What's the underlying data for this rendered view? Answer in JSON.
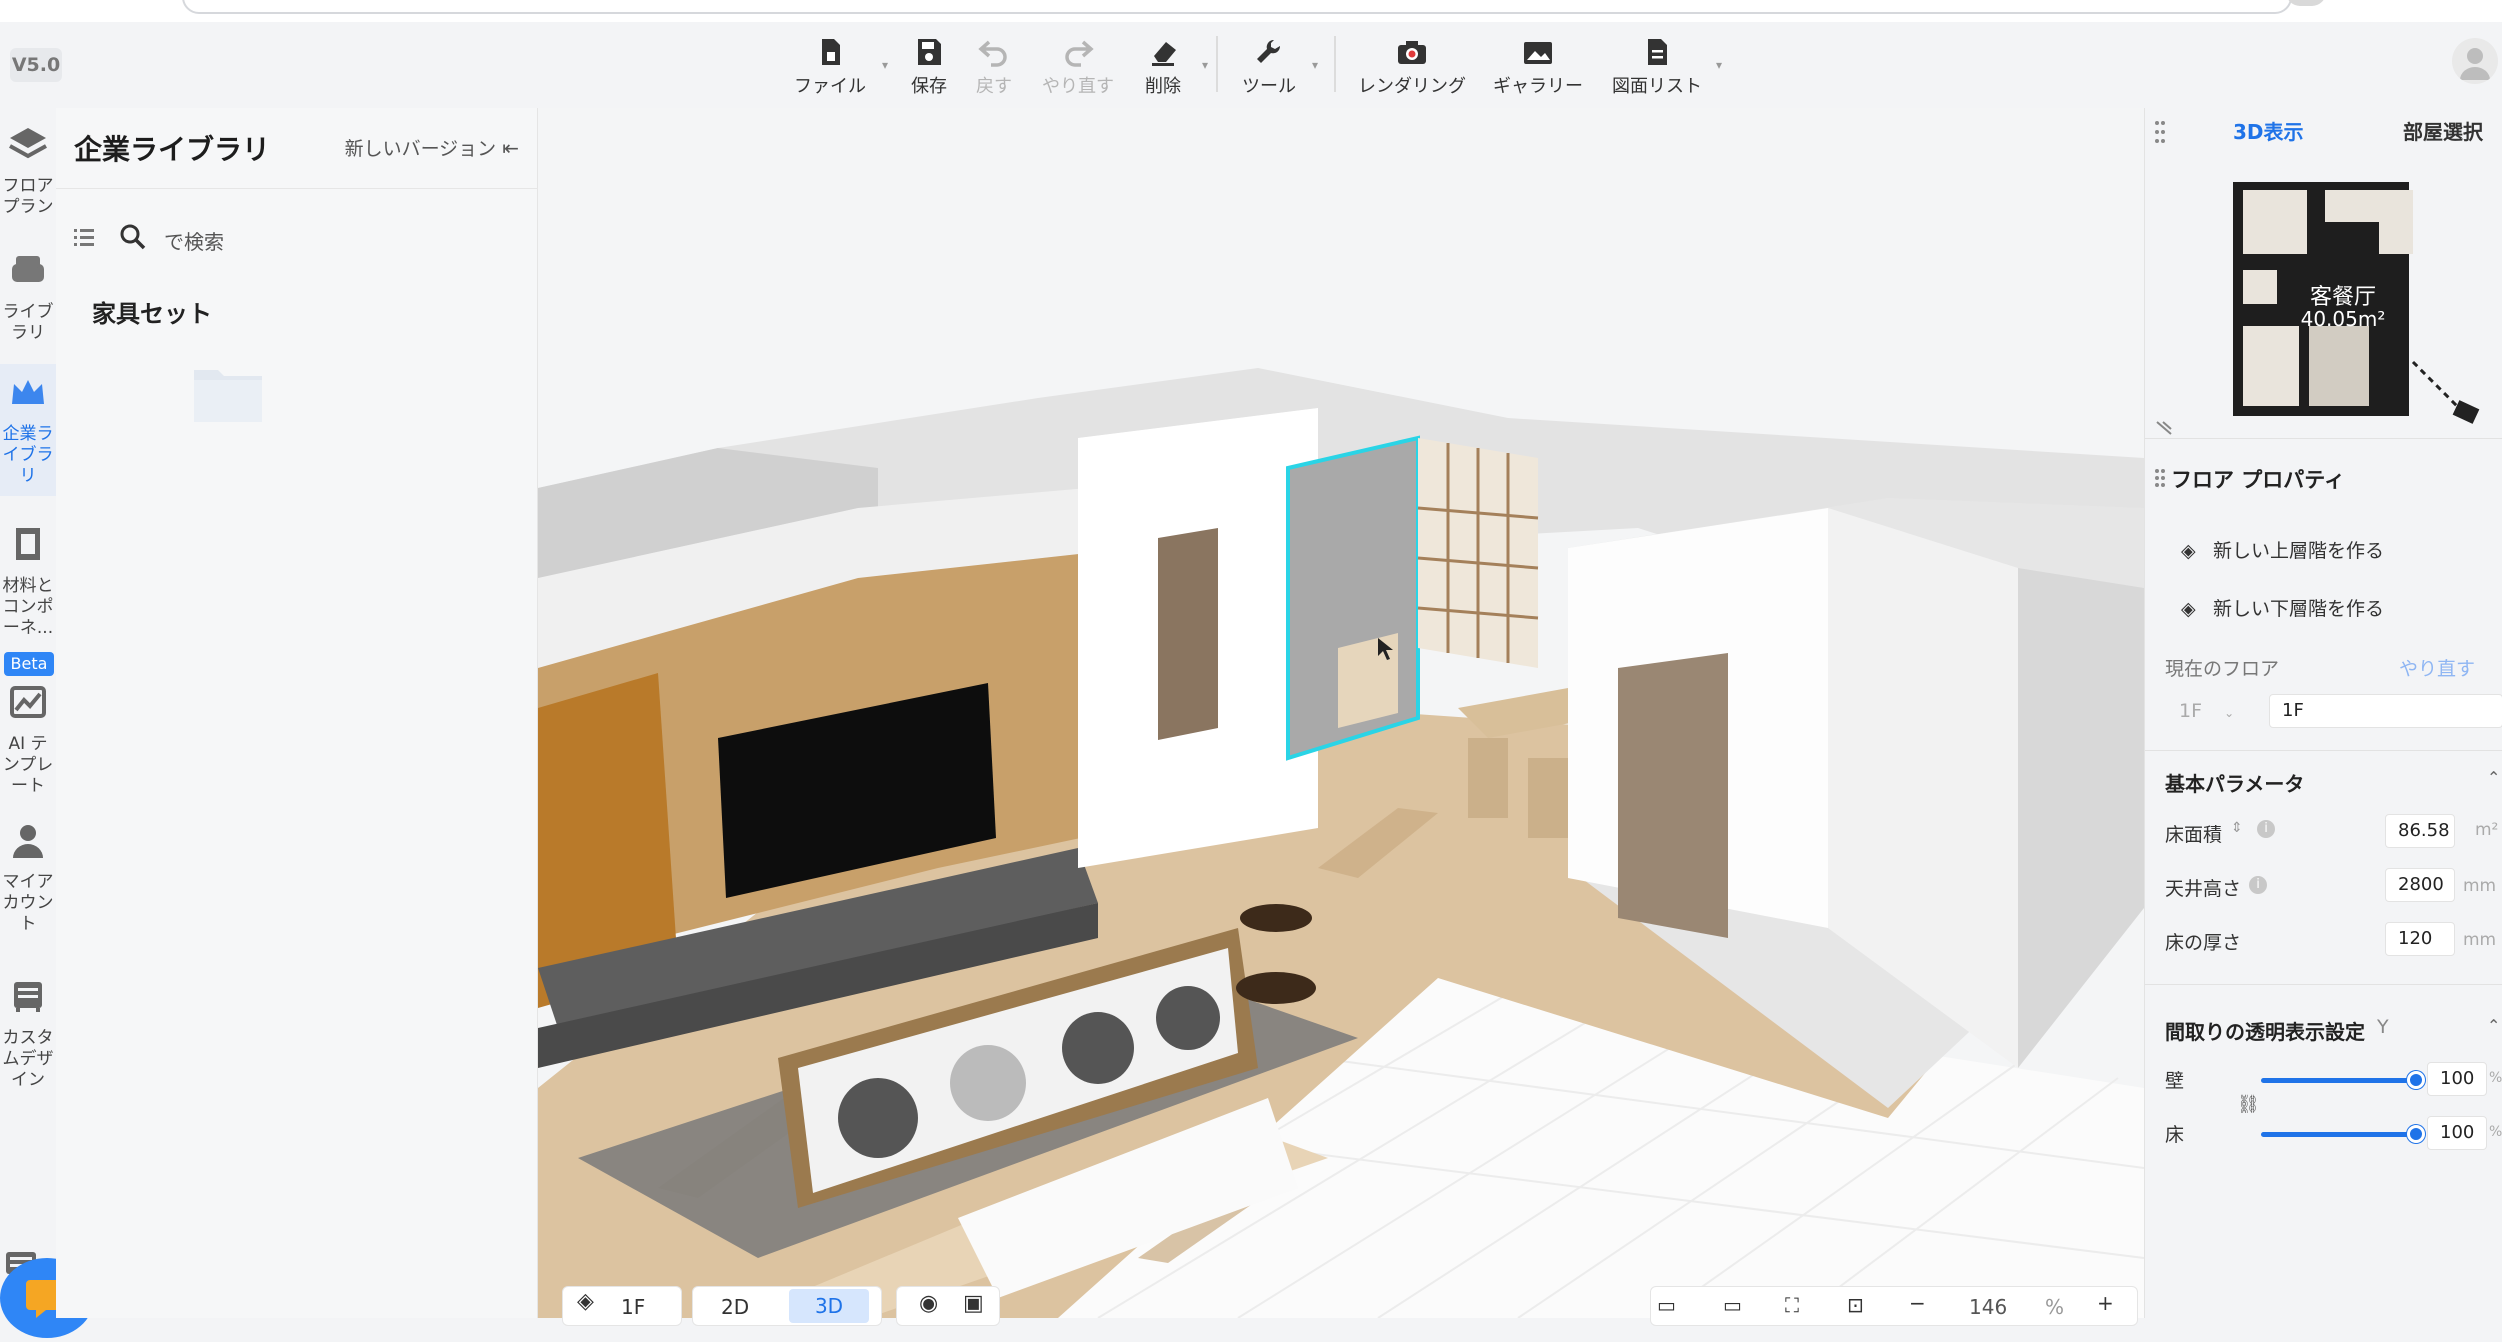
{
  "version": "V5.0",
  "toolbar": {
    "file": "ファイル",
    "save": "保存",
    "undo": "戻す",
    "redo": "やり直す",
    "delete": "削除",
    "tools": "ツール",
    "render": "レンダリング",
    "gallery": "ギャラリー",
    "drawings": "図面リスト"
  },
  "rail": {
    "items": [
      {
        "label": "フロア\nプラン",
        "icon": "floorplan-icon"
      },
      {
        "label": "ライブ\nラリ",
        "icon": "library-icon"
      },
      {
        "label": "企業ラ\nイブラ\nリ",
        "icon": "crown-icon"
      },
      {
        "label": "材料と\nコンポ\nーネ...",
        "icon": "material-icon"
      },
      {
        "label": "AI テ\nンプレ\nート",
        "icon": "ai-template-icon"
      },
      {
        "label": "マイア\nカウン\nト",
        "icon": "account-icon"
      },
      {
        "label": "カスタ\nムデザ\nイン",
        "icon": "custom-design-icon"
      }
    ],
    "beta": "Beta"
  },
  "library": {
    "title": "企業ライブラリ",
    "new_version": "新しいバージョン",
    "search_placeholder": "で検索",
    "section": "家具セット"
  },
  "right_panel": {
    "tab_3d": "3D表示",
    "tab_room": "部屋選択",
    "minimap_room": "客餐厅",
    "minimap_area": "40.05m²",
    "floor_props": "フロア プロパティ",
    "new_upper": "新しい上層階を作る",
    "new_lower": "新しい下層階を作る",
    "current_floor": "現在のフロア",
    "redo": "やり直す",
    "floor_select": "1F",
    "floor_name": "1F",
    "basic_params": "基本パラメータ",
    "floor_area_label": "床面積",
    "floor_area_value": "86.58",
    "floor_area_unit": "m²",
    "ceiling_label": "天井高さ",
    "ceiling_value": "2800",
    "ceiling_unit": "mm",
    "thickness_label": "床の厚さ",
    "thickness_value": "120",
    "thickness_unit": "mm",
    "transparency_title": "間取りの透明表示設定",
    "transparency_key": "Y",
    "wall_label": "壁",
    "wall_value": "100",
    "floor_label": "床",
    "floor_value": "100",
    "percent": "%"
  },
  "bottom": {
    "floor": "1F",
    "mode_2d": "2D",
    "mode_3d": "3D",
    "zoom": "146",
    "zoom_unit": "%"
  },
  "colors": {
    "accent": "#1f73e8",
    "selection": "#2ad4e6"
  }
}
